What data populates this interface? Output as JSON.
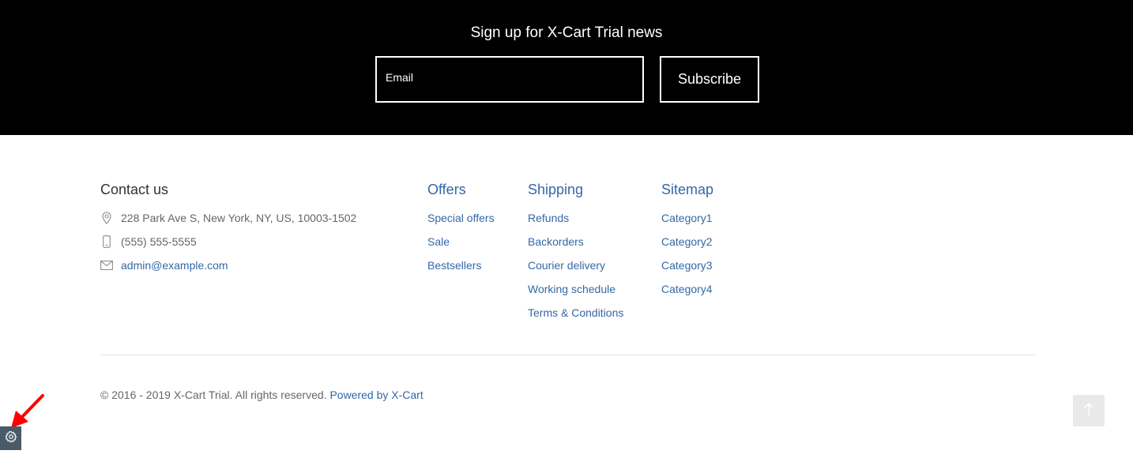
{
  "newsletter": {
    "title": "Sign up for X-Cart Trial news",
    "email_placeholder": "Email",
    "email_value": "",
    "subscribe_label": "Subscribe"
  },
  "contact": {
    "title": "Contact us",
    "address": "228 Park Ave S, New York, NY, US, 10003-1502",
    "phone": "(555) 555-5555",
    "email": "admin@example.com",
    "icons": [
      "map-pin-icon",
      "phone-icon",
      "envelope-icon"
    ]
  },
  "offers": {
    "title": "Offers",
    "items": [
      "Special offers",
      "Sale",
      "Bestsellers"
    ]
  },
  "shipping": {
    "title": "Shipping",
    "items": [
      "Refunds",
      "Backorders",
      "Courier delivery",
      "Working schedule",
      "Terms & Conditions"
    ]
  },
  "sitemap": {
    "title": "Sitemap",
    "items": [
      "Category1",
      "Category2",
      "Category3",
      "Category4"
    ]
  },
  "footer": {
    "copyright": "© 2016 - 2019 X-Cart Trial. All rights reserved.",
    "powered_by": "Powered by X-Cart"
  },
  "controls": {
    "back_to_top_icon": "arrow-up-icon",
    "settings_icon": "gear-icon",
    "annotation_icon": "red-arrow-icon"
  },
  "colors": {
    "newsletter_bg": "#000000",
    "link": "#3468a6",
    "text_muted": "#666666",
    "settings_bg": "#4a5a69",
    "annotation": "#ff0000"
  }
}
